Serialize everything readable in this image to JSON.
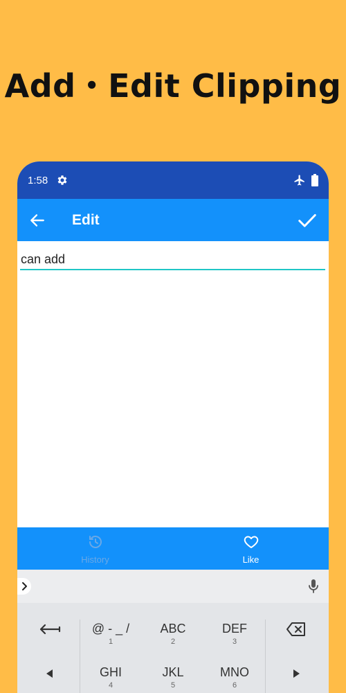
{
  "headline": "Add・Edit Clipping",
  "status_bar": {
    "time": "1:58",
    "icons": [
      "gear-icon",
      "airplane-icon",
      "battery-icon"
    ]
  },
  "app_bar": {
    "title": "Edit",
    "back_icon": "arrow-left-icon",
    "done_icon": "check-icon"
  },
  "editor": {
    "value": "can add"
  },
  "bottom_nav": {
    "items": [
      {
        "label": "History",
        "icon": "history-icon",
        "active": false
      },
      {
        "label": "Like",
        "icon": "heart-icon",
        "active": true
      }
    ]
  },
  "keyboard": {
    "suggest_icons": [
      "chevron-right-icon",
      "microphone-icon"
    ],
    "row1": [
      {
        "main": "",
        "sub": "",
        "icon": "arrow-left-icon"
      },
      {
        "main": "@ - _ /",
        "sub": "1"
      },
      {
        "main": "ABC",
        "sub": "2"
      },
      {
        "main": "DEF",
        "sub": "3"
      },
      {
        "main": "",
        "sub": "",
        "icon": "backspace-icon"
      }
    ],
    "row2": [
      {
        "main": "",
        "sub": "",
        "icon": "triangle-left-icon"
      },
      {
        "main": "GHI",
        "sub": "4"
      },
      {
        "main": "JKL",
        "sub": "5"
      },
      {
        "main": "MNO",
        "sub": "6"
      },
      {
        "main": "",
        "sub": "",
        "icon": "triangle-right-icon"
      }
    ]
  },
  "colors": {
    "background": "#FFBC47",
    "status_bar": "#1C4DB5",
    "app_bar": "#1391FB",
    "input_underline": "#1FC6C6",
    "keyboard": "#E3E5E8"
  }
}
